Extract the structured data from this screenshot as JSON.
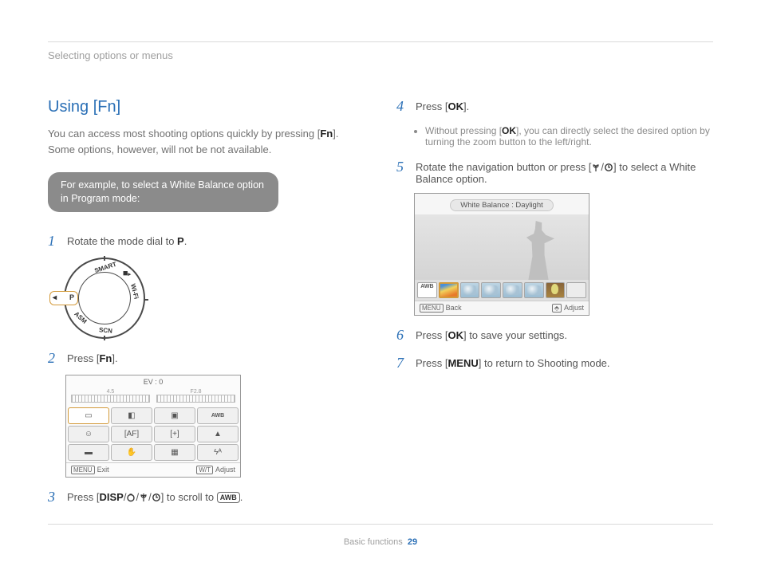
{
  "breadcrumb": "Selecting options or menus",
  "heading": "Using [Fn]",
  "intro": {
    "a": "You can access most shooting options quickly by pressing [",
    "fn": "Fn",
    "b": "]. Some options, however, will not be not available."
  },
  "pill": {
    "l1": "For example, to select a White Balance option",
    "l2": "in Program mode:"
  },
  "steps": {
    "1": {
      "a": "Rotate the mode dial to ",
      "p": "P",
      "b": "."
    },
    "2": {
      "a": "Press [",
      "fn": "Fn",
      "b": "]."
    },
    "3": {
      "a": "Press [",
      "disp": "DISP",
      "sep": "/",
      "b": "] to scroll to ",
      "awb": "AWB",
      "c": "."
    },
    "4": {
      "a": "Press [",
      "ok": "OK",
      "b": "]."
    },
    "4sub": {
      "a": "Without pressing [",
      "ok": "OK",
      "b": "], you can directly select the desired option by turning the zoom button to the left/right."
    },
    "5": {
      "a": "Rotate the navigation button or press [",
      "b": "] to select a White Balance option."
    },
    "6": {
      "a": "Press [",
      "ok": "OK",
      "b": "] to save your settings."
    },
    "7": {
      "a": "Press [",
      "menu": "MENU",
      "b": "] to return to Shooting mode."
    }
  },
  "dial": {
    "smart": "SMART",
    "wifi": "Wi-Fi",
    "scn": "SCN",
    "asm": "ASM",
    "p": "P"
  },
  "fn": {
    "ev": "EV : 0",
    "tl": "4.5",
    "tr": "F2.8",
    "exit": "Exit",
    "adjust": "Adjust",
    "menu": "MENU",
    "wt": "W/T",
    "awb": "AWB"
  },
  "wb": {
    "title": "White Balance : Daylight",
    "back": "Back",
    "adjust": "Adjust",
    "menu": "MENU",
    "auto": "AWB"
  },
  "footer": {
    "label": "Basic functions",
    "page": "29"
  },
  "icons": {
    "macro": "❀",
    "timer": "⟳",
    "disp": "DISP",
    "ok": "OK",
    "menu": "MENU",
    "bulb": "💡"
  }
}
